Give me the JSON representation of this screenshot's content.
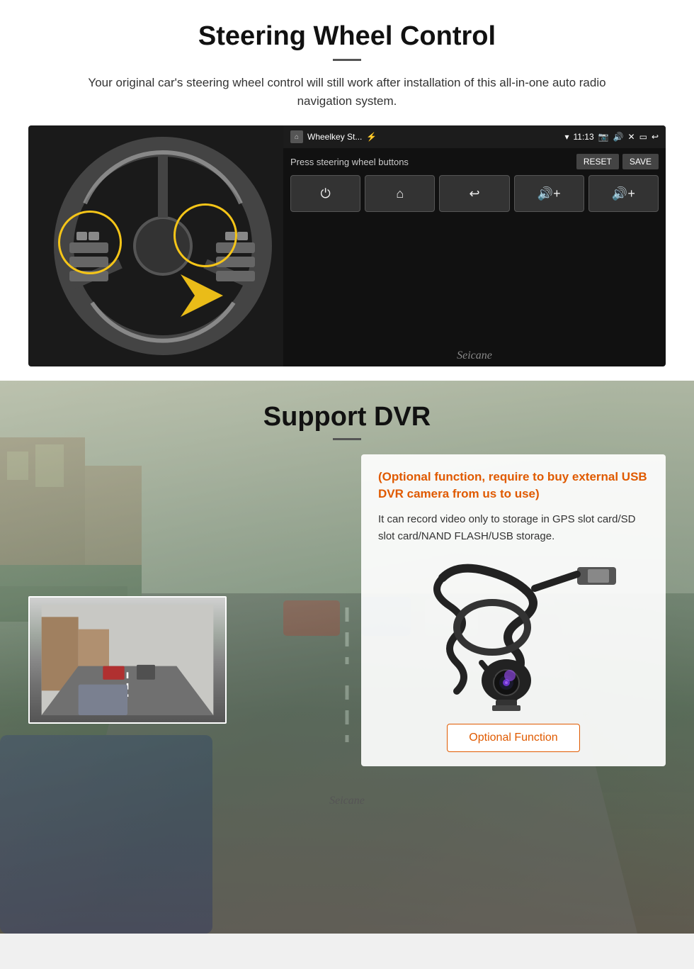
{
  "steering": {
    "title": "Steering Wheel Control",
    "description": "Your original car's steering wheel control will still work after installation of this all-in-one auto radio navigation system.",
    "statusbar": {
      "app_name": "Wheelkey St...",
      "time": "11:13",
      "icons": [
        "wifi",
        "camera",
        "volume",
        "close",
        "screen",
        "back"
      ]
    },
    "control_header": "Press steering wheel buttons",
    "reset_label": "RESET",
    "save_label": "SAVE",
    "buttons": [
      "⏻",
      "⌂",
      "↩",
      "🔊+",
      "🔊+"
    ],
    "watermark": "Seicane"
  },
  "dvr": {
    "title": "Support DVR",
    "optional_notice": "(Optional function, require to buy external USB DVR camera from us to use)",
    "description": "It can record video only to storage in GPS slot card/SD slot card/NAND FLASH/USB storage.",
    "optional_function_label": "Optional Function",
    "watermark": "Seicane"
  }
}
